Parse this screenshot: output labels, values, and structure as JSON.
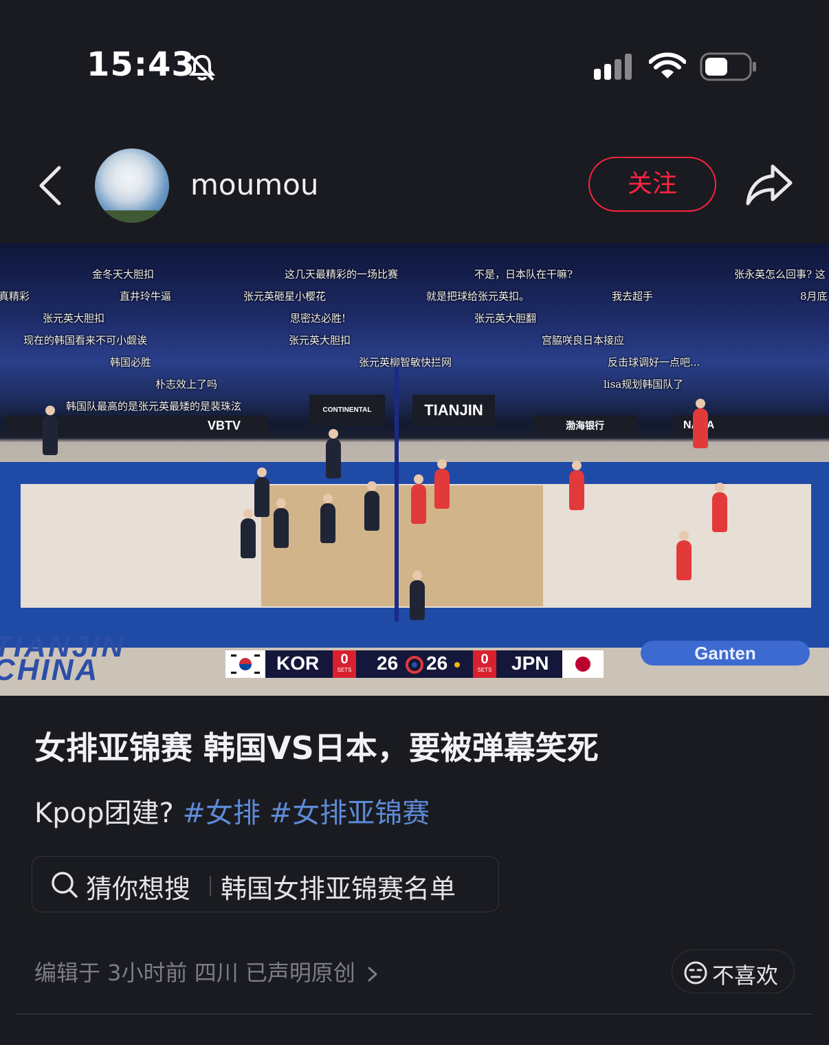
{
  "status_bar": {
    "time": "15:43",
    "icons": [
      "bell-slash-icon",
      "signal-icon",
      "wifi-icon",
      "battery-icon"
    ]
  },
  "header": {
    "username": "moumou",
    "follow_label": "关注"
  },
  "video": {
    "danmaku": [
      "金冬天大胆扣",
      "这几天最精彩的一场比赛",
      "不是，日本队在干嘛?",
      "张永英怎么回事? 这",
      "真精彩",
      "直井玲牛逼",
      "张元英砸星小樱花",
      "就是把球给张元英扣。",
      "我去超手",
      "8月底",
      "张元英大胆扣",
      "思密达必胜!",
      "张元英大胆翻",
      "现在的韩国看来不可小觑诶",
      "张元英大胆扣",
      "宫脇咲良日本接应",
      "韩国必胜",
      "张元英柳智敏快拦网",
      "反击球调好一点吧...",
      "朴志效上了吗",
      "lisa规划韩国队了",
      "韩国队最高的是张元英最矮的是裴珠泫"
    ],
    "banners": {
      "tianjin": "TIANJIN",
      "vbtv": "VBTV",
      "continental": "CONTINENTAL",
      "bohai": "渤海银行",
      "nasa": "NASA"
    },
    "floor_text": {
      "tianjin": "TIANJIN",
      "china": "CHINA",
      "sponsor": "Ganten"
    },
    "scoreboard": {
      "home_team": "KOR",
      "home_sets": "0",
      "home_points": "26",
      "away_points": "26",
      "away_sets": "0",
      "away_team": "JPN",
      "sets_label": "SETS"
    }
  },
  "post": {
    "title": "女排亚锦赛 韩国VS日本，要被弹幕笑死",
    "desc_text": "Kpop团建?",
    "tags": [
      "#女排",
      "#女排亚锦赛"
    ]
  },
  "search": {
    "label": "猜你想搜",
    "suggestion": "韩国女排亚锦赛名单"
  },
  "meta": {
    "text": "编辑于 3小时前 四川 已声明原创"
  },
  "dislike": {
    "label": "不喜欢"
  },
  "colors": {
    "accent": "#ff2442",
    "tag": "#5d8bd8",
    "background": "#1a1b20"
  }
}
